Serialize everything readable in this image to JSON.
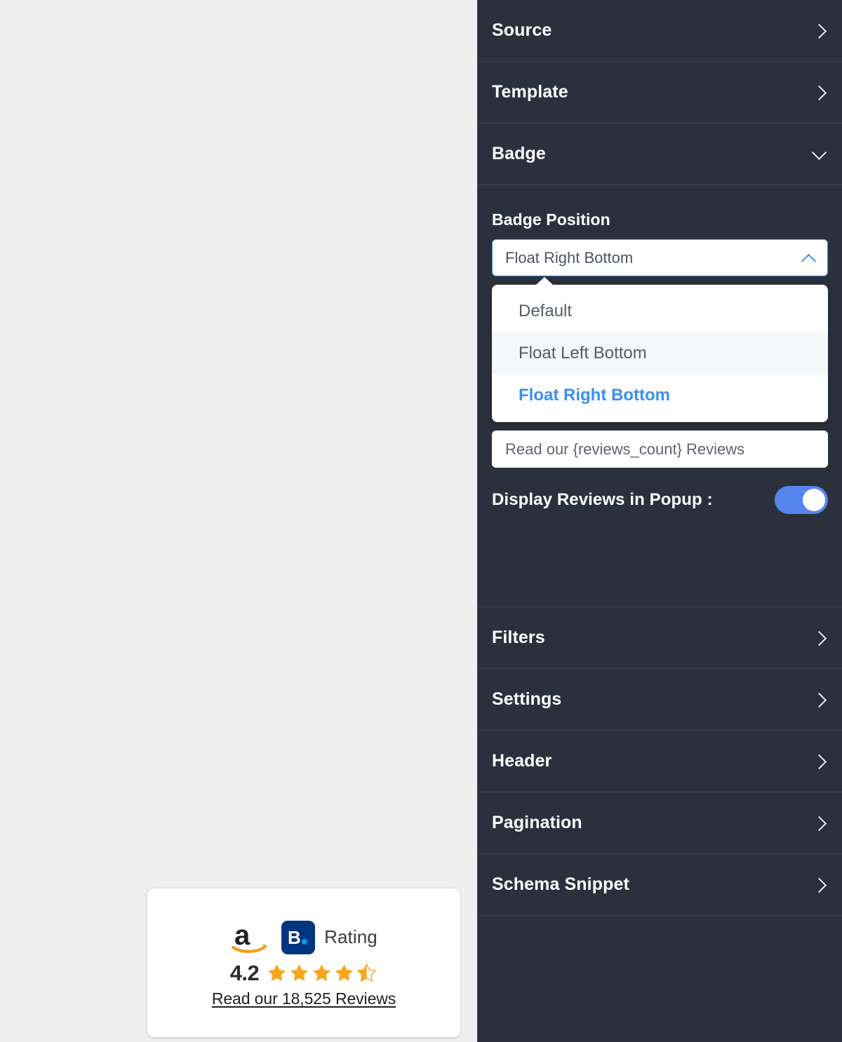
{
  "preview": {
    "background_color": "#efefef",
    "badge_widget": {
      "amazon_logo": "amazon-logo",
      "booking_logo": "booking-logo",
      "booking_letter": "B.",
      "rating_word": "Rating",
      "score": "4.2",
      "stars_filled": 4,
      "stars_half": 1,
      "stars_total": 5,
      "star_color": "#f8a51b",
      "link_text": "Read our 18,525 Reviews",
      "reviews_count": "18,525"
    }
  },
  "panel": {
    "background_color": "#2b313c",
    "accent_color": "#3b8ff0",
    "rows_top": [
      {
        "label": "Source",
        "icon": "chevron-right-icon",
        "expanded": false
      },
      {
        "label": "Template",
        "icon": "chevron-right-icon",
        "expanded": false
      },
      {
        "label": "Badge",
        "icon": "chevron-down-icon",
        "expanded": true
      }
    ],
    "badge_section": {
      "field_label": "Badge Position",
      "select_value": "Float Right Bottom",
      "select_icon": "chevron-up-icon",
      "options": [
        {
          "label": "Default",
          "state": "normal"
        },
        {
          "label": "Float Left Bottom",
          "state": "hovered"
        },
        {
          "label": "Float Right Bottom",
          "state": "selected"
        }
      ],
      "badge_text_input": {
        "value": "",
        "placeholder": "Read our {reviews_count} Reviews"
      },
      "toggle": {
        "label": "Display Reviews in Popup :",
        "on": true,
        "color": "#5585ee"
      }
    },
    "rows_bottom": [
      {
        "label": "Filters",
        "icon": "chevron-right-icon"
      },
      {
        "label": "Settings",
        "icon": "chevron-right-icon"
      },
      {
        "label": "Header",
        "icon": "chevron-right-icon"
      },
      {
        "label": "Pagination",
        "icon": "chevron-right-icon"
      },
      {
        "label": "Schema Snippet",
        "icon": "chevron-right-icon"
      }
    ]
  }
}
